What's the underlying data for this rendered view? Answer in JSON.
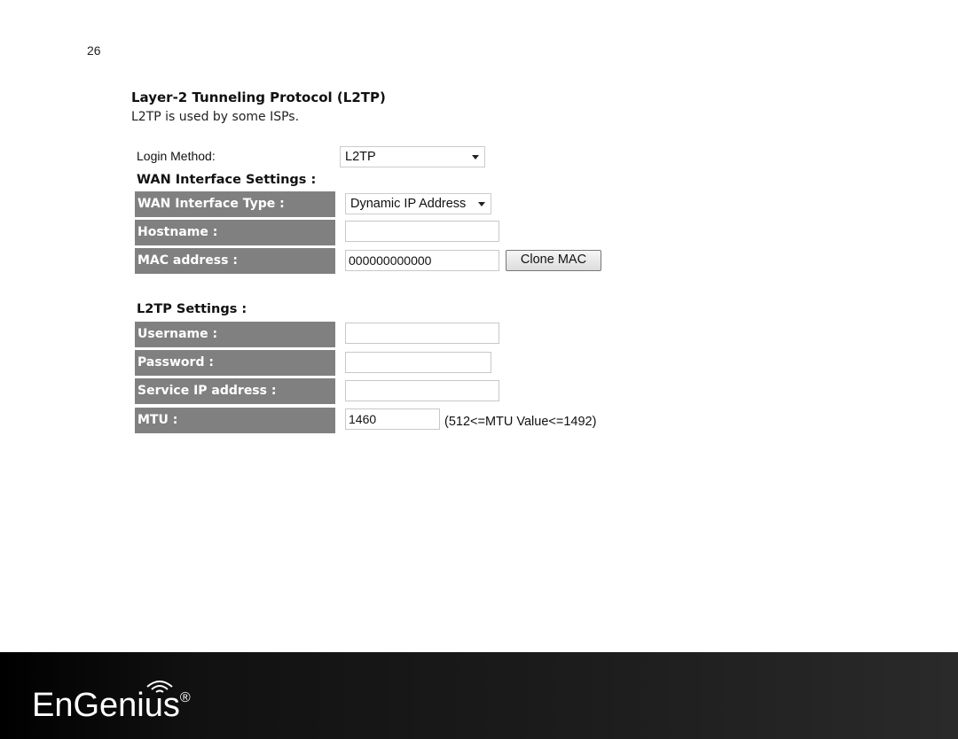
{
  "page_number": "26",
  "section_title": "Layer-2 Tunneling Protocol (L2TP)",
  "section_description": "L2TP is used by some ISPs.",
  "form": {
    "login_method_label": "Login Method:",
    "login_method_value": "L2TP",
    "wan_settings_heading": "WAN Interface Settings :",
    "wan_interface_type_label": "WAN Interface Type :",
    "wan_interface_type_value": "Dynamic IP Address",
    "hostname_label": "Hostname :",
    "hostname_value": "",
    "mac_label": "MAC address :",
    "mac_value": "000000000000",
    "clone_mac_button": "Clone MAC",
    "l2tp_settings_heading": "L2TP Settings :",
    "username_label": "Username :",
    "username_value": "",
    "password_label": "Password :",
    "password_value": "",
    "service_ip_label": "Service IP address :",
    "service_ip_value": "",
    "mtu_label": "MTU :",
    "mtu_value": "1460",
    "mtu_hint": "(512<=MTU Value<=1492)"
  },
  "footer": {
    "logo_text": "EnGenius",
    "registered_mark": "®"
  },
  "colors": {
    "label_row_bg": "#808080",
    "footer_bg": "#111111"
  }
}
